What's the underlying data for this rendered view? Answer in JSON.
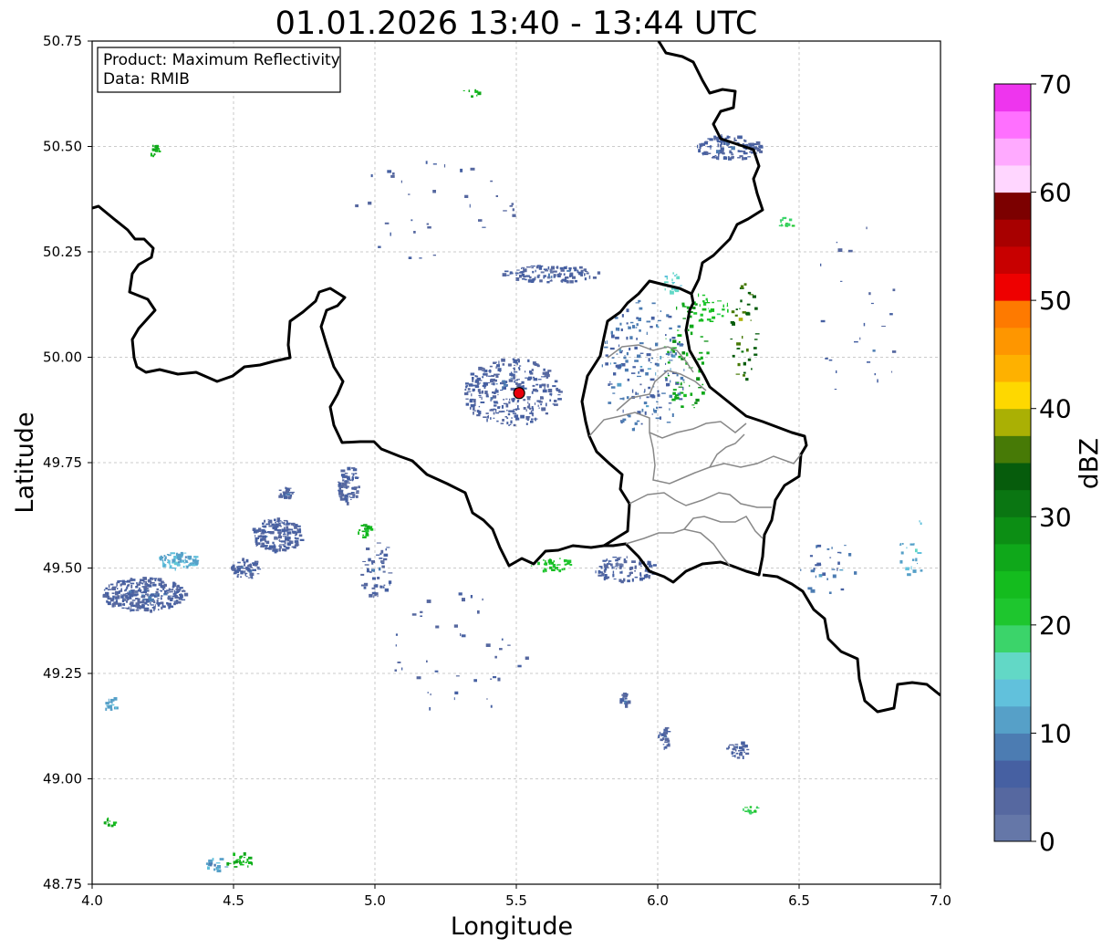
{
  "chart_data": {
    "type": "heatmap",
    "title": "01.01.2026 13:40 - 13:44 UTC",
    "xlabel": "Longitude",
    "ylabel": "Latitude",
    "xlim": [
      4.0,
      7.0
    ],
    "ylim": [
      48.75,
      50.75
    ],
    "x_ticks": [
      4.0,
      4.5,
      5.0,
      5.5,
      6.0,
      6.5,
      7.0
    ],
    "x_tick_labels": [
      "4.0",
      "4.5",
      "5.0",
      "5.5",
      "6.0",
      "6.5",
      "7.0"
    ],
    "y_ticks": [
      48.75,
      49.0,
      49.25,
      49.5,
      49.75,
      50.0,
      50.25,
      50.5,
      50.75
    ],
    "y_tick_labels": [
      "48.75",
      "49.00",
      "49.25",
      "49.50",
      "49.75",
      "50.00",
      "50.25",
      "50.50",
      "50.75"
    ],
    "grid": true,
    "annotation": {
      "lines": [
        "Product: Maximum Reflectivity",
        "Data: RMIB"
      ],
      "placement": "top-left"
    },
    "radar_site": {
      "lon": 5.51,
      "lat": 49.915,
      "color": "#e8000b"
    },
    "colorbar": {
      "label": "dBZ",
      "min": 0,
      "max": 70,
      "step": 2.5,
      "ticks": [
        0,
        10,
        20,
        30,
        40,
        50,
        60,
        70
      ],
      "tick_labels": [
        "0",
        "10",
        "20",
        "30",
        "40",
        "50",
        "60",
        "70"
      ],
      "colors": [
        "#6577a8",
        "#5668a0",
        "#4660a2",
        "#4c7cb2",
        "#56a0c8",
        "#61c1dc",
        "#62d8c6",
        "#3bd46a",
        "#1ec62e",
        "#14bc1e",
        "#0fa81a",
        "#0c8e14",
        "#0a7612",
        "#065c0c",
        "#477a06",
        "#aab004",
        "#fed800",
        "#feb100",
        "#fe9600",
        "#fe7a00",
        "#ee0000",
        "#c80000",
        "#a80000",
        "#7c0000",
        "#ffd6ff",
        "#ffaaff",
        "#ff70ff",
        "#ee35ee"
      ]
    },
    "echoes": [
      {
        "lon": 4.18,
        "lat": 49.44,
        "w": 0.3,
        "h": 0.08,
        "dbz": 5,
        "n": 320
      },
      {
        "lon": 4.3,
        "lat": 49.52,
        "w": 0.14,
        "h": 0.04,
        "dbz": 12,
        "n": 90
      },
      {
        "lon": 4.65,
        "lat": 49.58,
        "w": 0.18,
        "h": 0.08,
        "dbz": 5,
        "n": 170
      },
      {
        "lon": 4.54,
        "lat": 49.5,
        "w": 0.1,
        "h": 0.05,
        "dbz": 5,
        "n": 60
      },
      {
        "lon": 4.9,
        "lat": 49.7,
        "w": 0.08,
        "h": 0.09,
        "dbz": 5,
        "n": 80
      },
      {
        "lon": 4.68,
        "lat": 49.68,
        "w": 0.05,
        "h": 0.03,
        "dbz": 5,
        "n": 25
      },
      {
        "lon": 5.0,
        "lat": 49.5,
        "w": 0.12,
        "h": 0.14,
        "dbz": 5,
        "n": 50
      },
      {
        "lon": 4.96,
        "lat": 49.59,
        "w": 0.05,
        "h": 0.03,
        "dbz": 25,
        "n": 20
      },
      {
        "lon": 5.48,
        "lat": 49.92,
        "w": 0.34,
        "h": 0.16,
        "dbz": 5,
        "n": 300
      },
      {
        "lon": 5.62,
        "lat": 50.2,
        "w": 0.34,
        "h": 0.04,
        "dbz": 5,
        "n": 110
      },
      {
        "lon": 5.95,
        "lat": 49.98,
        "w": 0.3,
        "h": 0.32,
        "dbz": 8,
        "n": 180
      },
      {
        "lon": 6.1,
        "lat": 50.0,
        "w": 0.16,
        "h": 0.28,
        "dbz": 27,
        "n": 70
      },
      {
        "lon": 6.18,
        "lat": 50.12,
        "w": 0.14,
        "h": 0.08,
        "dbz": 22,
        "n": 30
      },
      {
        "lon": 6.3,
        "lat": 50.06,
        "w": 0.1,
        "h": 0.25,
        "dbz": 35,
        "n": 40
      },
      {
        "lon": 5.88,
        "lat": 49.5,
        "w": 0.22,
        "h": 0.06,
        "dbz": 5,
        "n": 90
      },
      {
        "lon": 5.62,
        "lat": 49.51,
        "w": 0.16,
        "h": 0.03,
        "dbz": 22,
        "n": 40
      },
      {
        "lon": 6.25,
        "lat": 50.5,
        "w": 0.24,
        "h": 0.06,
        "dbz": 5,
        "n": 130
      },
      {
        "lon": 6.05,
        "lat": 50.18,
        "w": 0.07,
        "h": 0.05,
        "dbz": 15,
        "n": 20
      },
      {
        "lon": 6.28,
        "lat": 49.07,
        "w": 0.08,
        "h": 0.04,
        "dbz": 5,
        "n": 35
      },
      {
        "lon": 5.88,
        "lat": 49.19,
        "w": 0.03,
        "h": 0.03,
        "dbz": 5,
        "n": 20
      },
      {
        "lon": 6.02,
        "lat": 49.1,
        "w": 0.04,
        "h": 0.05,
        "dbz": 5,
        "n": 25
      },
      {
        "lon": 6.33,
        "lat": 48.93,
        "w": 0.06,
        "h": 0.02,
        "dbz": 20,
        "n": 15
      },
      {
        "lon": 4.52,
        "lat": 48.81,
        "w": 0.1,
        "h": 0.04,
        "dbz": 25,
        "n": 25
      },
      {
        "lon": 4.43,
        "lat": 48.8,
        "w": 0.09,
        "h": 0.03,
        "dbz": 12,
        "n": 20
      },
      {
        "lon": 4.06,
        "lat": 48.9,
        "w": 0.04,
        "h": 0.02,
        "dbz": 25,
        "n": 10
      },
      {
        "lon": 4.06,
        "lat": 49.18,
        "w": 0.05,
        "h": 0.04,
        "dbz": 12,
        "n": 15
      },
      {
        "lon": 4.22,
        "lat": 50.49,
        "w": 0.03,
        "h": 0.04,
        "dbz": 25,
        "n": 15
      },
      {
        "lon": 6.45,
        "lat": 50.32,
        "w": 0.06,
        "h": 0.03,
        "dbz": 20,
        "n": 15
      },
      {
        "lon": 6.9,
        "lat": 49.55,
        "w": 0.1,
        "h": 0.15,
        "dbz": 12,
        "n": 20
      },
      {
        "lon": 5.34,
        "lat": 50.63,
        "w": 0.06,
        "h": 0.02,
        "dbz": 25,
        "n": 8
      },
      {
        "lon": 6.6,
        "lat": 49.5,
        "w": 0.2,
        "h": 0.14,
        "dbz": 8,
        "n": 30
      },
      {
        "lon": 5.3,
        "lat": 49.3,
        "w": 0.5,
        "h": 0.3,
        "dbz": 5,
        "n": 40
      },
      {
        "lon": 5.2,
        "lat": 50.35,
        "w": 0.6,
        "h": 0.25,
        "dbz": 5,
        "n": 35
      },
      {
        "lon": 6.7,
        "lat": 50.1,
        "w": 0.3,
        "h": 0.5,
        "dbz": 5,
        "n": 25
      }
    ]
  }
}
